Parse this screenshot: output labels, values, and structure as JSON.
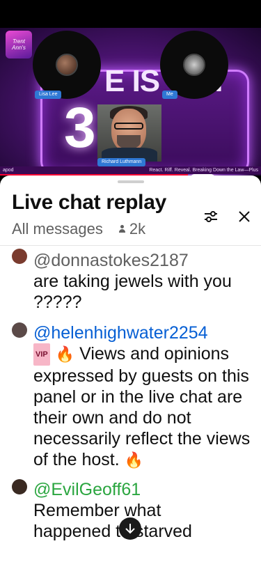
{
  "video": {
    "headline": "E IS TICI",
    "days": "3 DAYS",
    "logo_text": "Trent Ann's",
    "participants": {
      "left": "Lisa Lee",
      "right": "Me",
      "host": "Richard Luthmann"
    },
    "ticker_left": "apod",
    "ticker_right": "React. Riff. Reveal. Breaking Down the Law—Plus",
    "progress_fraction": 0.72
  },
  "chat": {
    "title": "Live chat replay",
    "filter_label": "All messages",
    "viewer_count": "2k",
    "icons": {
      "tune": "tune-icon",
      "close": "close-icon",
      "scroll_down": "arrow-down-icon"
    },
    "messages": [
      {
        "author": "@donnastokes2187",
        "author_color": "#606060",
        "text": "are taking jewels with you ?????",
        "avatar_color": "#7a3b2e"
      },
      {
        "author": "@helenhighwater2254",
        "author_color": "#065fd4",
        "badge": "VIP",
        "fire": "🔥",
        "text": "Views and opinions expressed by guests on this panel or in the live chat are their own and do not necessarily reflect the views of the host.",
        "fire_end": "🔥",
        "avatar_color": "#5b4a48"
      },
      {
        "author": "@EvilGeoff61",
        "author_color": "#2ba640",
        "text": "Remember what happened to starved",
        "avatar_color": "#3a2a22"
      }
    ]
  }
}
